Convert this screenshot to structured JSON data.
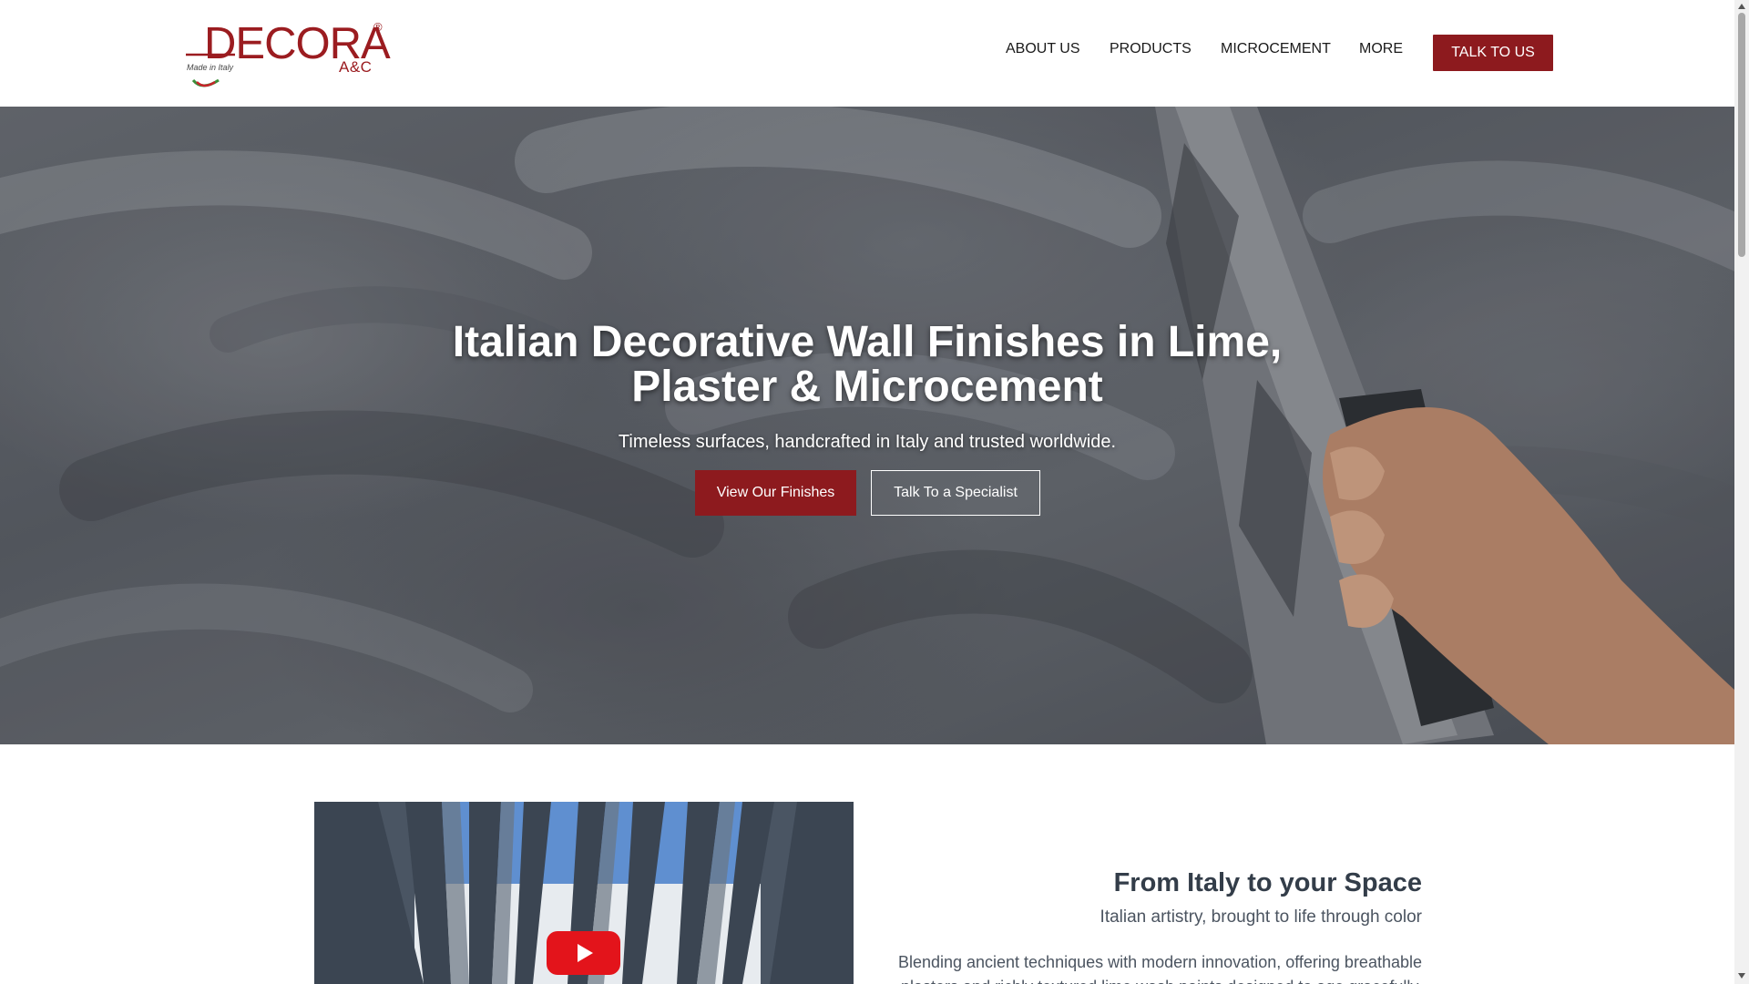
{
  "brand": {
    "name": "DECORA",
    "sub": "A&C",
    "registered": "®",
    "made_in": "Made in Italy",
    "color": "#8d1a1e"
  },
  "nav": {
    "items": [
      "ABOUT US",
      "PRODUCTS",
      "MICROCEMENT",
      "MORE"
    ],
    "cta": "TALK TO US"
  },
  "hero": {
    "title_line1": "Italian Decorative Wall Finishes in Lime,",
    "title_line2": "Plaster & Microcement",
    "subtitle": "Timeless surfaces, handcrafted in Italy and trusted worldwide.",
    "primary_button": "View Our Finishes",
    "secondary_button": "Talk To a Specialist"
  },
  "intro": {
    "heading": "From Italy to your Space",
    "tagline": "Italian artistry, brought to life through color",
    "body": "Blending ancient techniques with modern innovation, offering breathable plasters and richly textured lime wash paints designed to age gracefully."
  },
  "video": {
    "icon": "play-icon",
    "play_color": "#e3141b"
  }
}
